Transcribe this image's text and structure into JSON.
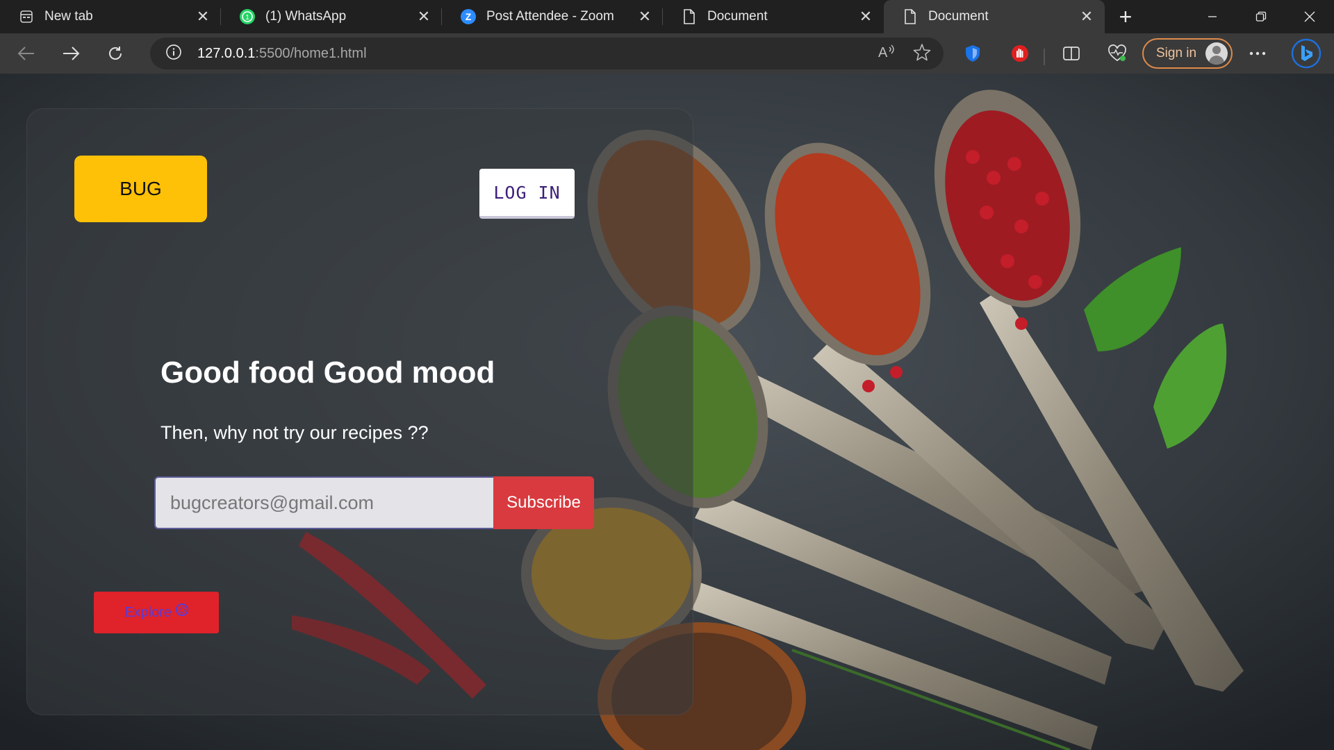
{
  "browser": {
    "tabs": [
      {
        "title": "New tab",
        "icon": "newtab-icon",
        "active": false
      },
      {
        "title": "(1) WhatsApp",
        "icon": "whatsapp-icon",
        "badge": "1",
        "active": false
      },
      {
        "title": "Post Attendee - Zoom",
        "icon": "zoom-icon",
        "badge": "Z",
        "active": false
      },
      {
        "title": "Document",
        "icon": "document-icon",
        "active": false
      },
      {
        "title": "Document",
        "icon": "document-icon",
        "active": true
      }
    ],
    "url_host": "127.0.0.1",
    "url_rest": ":5500/home1.html",
    "sign_in_label": "Sign in"
  },
  "colors": {
    "logo_bg": "#ffc107",
    "subscribe_bg": "#d83a3f",
    "explore_bg": "#e0222a",
    "explore_text": "#5a3bd6",
    "login_text": "#3b1f78",
    "signin_border": "#e08b4a"
  },
  "page": {
    "logo_text": "BUG",
    "login_label": "LOG IN",
    "headline": "Good food Good mood",
    "subline": "Then, why not try our recipes ??",
    "email_placeholder": "bugcreators@gmail.com",
    "subscribe_label": "Subscribe",
    "explore_label": "Explore",
    "background": "spices-on-spoons-photo"
  }
}
